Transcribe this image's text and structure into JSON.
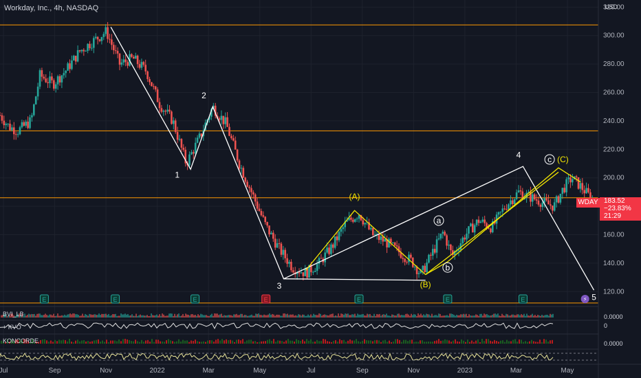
{
  "header": {
    "title": "Workday, Inc., 4h, NASDAQ",
    "currency": "USD"
  },
  "price_tag": {
    "ticker": "WDAY",
    "price": "183.52",
    "change": "−23.83%",
    "time": "21:29"
  },
  "indicators": [
    {
      "label": "BVI_LB",
      "value": "0.0000"
    },
    {
      "label": "+ KVO",
      "value": "0"
    },
    {
      "label": "KONCORDE",
      "value": "0.0000"
    }
  ],
  "colors": {
    "up": "#26a69a",
    "down": "#ef5350",
    "wave": "#ffffff",
    "corrective": "#f2e600",
    "level": "#ff9800",
    "badge_green": "#26a69a",
    "badge_red": "#f23645"
  },
  "chart_data": {
    "type": "candlestick",
    "title": "Workday, Inc., 4h, NASDAQ",
    "x_ticks": [
      "Jul",
      "Sep",
      "Nov",
      "2022",
      "Mar",
      "May",
      "Jul",
      "Sep",
      "Nov",
      "2023",
      "Mar",
      "May"
    ],
    "y_ticks": [
      120,
      140,
      160,
      180,
      200,
      220,
      240,
      260,
      280,
      300,
      320
    ],
    "ylim": [
      110,
      325
    ],
    "grid": true,
    "horizontal_levels": [
      307.5,
      233,
      186,
      112
    ],
    "last_price": 183.52,
    "price_path": [
      {
        "x": 0,
        "y": 244
      },
      {
        "x": 2,
        "y": 236
      },
      {
        "x": 4,
        "y": 233
      },
      {
        "x": 7,
        "y": 240
      },
      {
        "x": 9,
        "y": 272
      },
      {
        "x": 12,
        "y": 266
      },
      {
        "x": 15,
        "y": 276
      },
      {
        "x": 18,
        "y": 289
      },
      {
        "x": 21,
        "y": 296
      },
      {
        "x": 24,
        "y": 303
      },
      {
        "x": 27,
        "y": 280
      },
      {
        "x": 30,
        "y": 284
      },
      {
        "x": 33,
        "y": 275
      },
      {
        "x": 36,
        "y": 252
      },
      {
        "x": 39,
        "y": 240
      },
      {
        "x": 42,
        "y": 210
      },
      {
        "x": 45,
        "y": 228
      },
      {
        "x": 48,
        "y": 250
      },
      {
        "x": 51,
        "y": 238
      },
      {
        "x": 54,
        "y": 210
      },
      {
        "x": 57,
        "y": 188
      },
      {
        "x": 60,
        "y": 166
      },
      {
        "x": 63,
        "y": 150
      },
      {
        "x": 66,
        "y": 137
      },
      {
        "x": 69,
        "y": 133
      },
      {
        "x": 72,
        "y": 140
      },
      {
        "x": 75,
        "y": 152
      },
      {
        "x": 78,
        "y": 168
      },
      {
        "x": 81,
        "y": 175
      },
      {
        "x": 84,
        "y": 160
      },
      {
        "x": 87,
        "y": 155
      },
      {
        "x": 90,
        "y": 148
      },
      {
        "x": 93,
        "y": 141
      },
      {
        "x": 95,
        "y": 132
      },
      {
        "x": 98,
        "y": 150
      },
      {
        "x": 100,
        "y": 162
      },
      {
        "x": 102,
        "y": 145
      },
      {
        "x": 105,
        "y": 160
      },
      {
        "x": 108,
        "y": 170
      },
      {
        "x": 111,
        "y": 165
      },
      {
        "x": 114,
        "y": 180
      },
      {
        "x": 117,
        "y": 190
      },
      {
        "x": 120,
        "y": 186
      },
      {
        "x": 123,
        "y": 182
      },
      {
        "x": 125,
        "y": 180
      },
      {
        "x": 127,
        "y": 192
      },
      {
        "x": 129,
        "y": 200
      },
      {
        "x": 131,
        "y": 194
      },
      {
        "x": 133,
        "y": 187
      },
      {
        "x": 134,
        "y": 182
      }
    ],
    "wave_labels": [
      {
        "text": "1",
        "x": 40,
        "y": 200
      },
      {
        "text": "2",
        "x": 46,
        "y": 256
      },
      {
        "text": "3",
        "x": 63,
        "y": 122
      },
      {
        "text": "4",
        "x": 117,
        "y": 214
      },
      {
        "text": "5",
        "x": 134,
        "y": 114
      },
      {
        "text": "(A)",
        "x": 80,
        "y": 185
      },
      {
        "text": "(B)",
        "x": 96,
        "y": 123
      },
      {
        "text": "(C)",
        "x": 127,
        "y": 211
      },
      {
        "text": "a",
        "x": 99,
        "y": 168
      },
      {
        "text": "b",
        "x": 101,
        "y": 135
      },
      {
        "text": "c",
        "x": 124,
        "y": 211
      }
    ],
    "wave_lines": [
      {
        "color": "wave",
        "points": [
          [
            25,
            306
          ],
          [
            43,
            206
          ],
          [
            48,
            250
          ],
          [
            64,
            129
          ],
          [
            118,
            208
          ],
          [
            134,
            121
          ]
        ]
      },
      {
        "color": "wave",
        "points": [
          [
            64,
            129
          ],
          [
            96,
            128
          ]
        ]
      },
      {
        "color": "corrective",
        "points": [
          [
            69,
            135
          ],
          [
            80,
            177
          ],
          [
            96,
            132
          ],
          [
            101,
            141
          ],
          [
            126,
            207
          ],
          [
            131,
            197
          ]
        ]
      },
      {
        "color": "corrective",
        "points": [
          [
            96,
            132
          ],
          [
            126,
            204
          ]
        ]
      }
    ],
    "earnings_markers": [
      {
        "x": 10,
        "kind": "E"
      },
      {
        "x": 26,
        "kind": "E"
      },
      {
        "x": 44,
        "kind": "E"
      },
      {
        "x": 60,
        "kind": "E-red"
      },
      {
        "x": 81,
        "kind": "E"
      },
      {
        "x": 101,
        "kind": "E"
      },
      {
        "x": 118,
        "kind": "E"
      },
      {
        "x": 132,
        "kind": "lightning"
      }
    ]
  }
}
